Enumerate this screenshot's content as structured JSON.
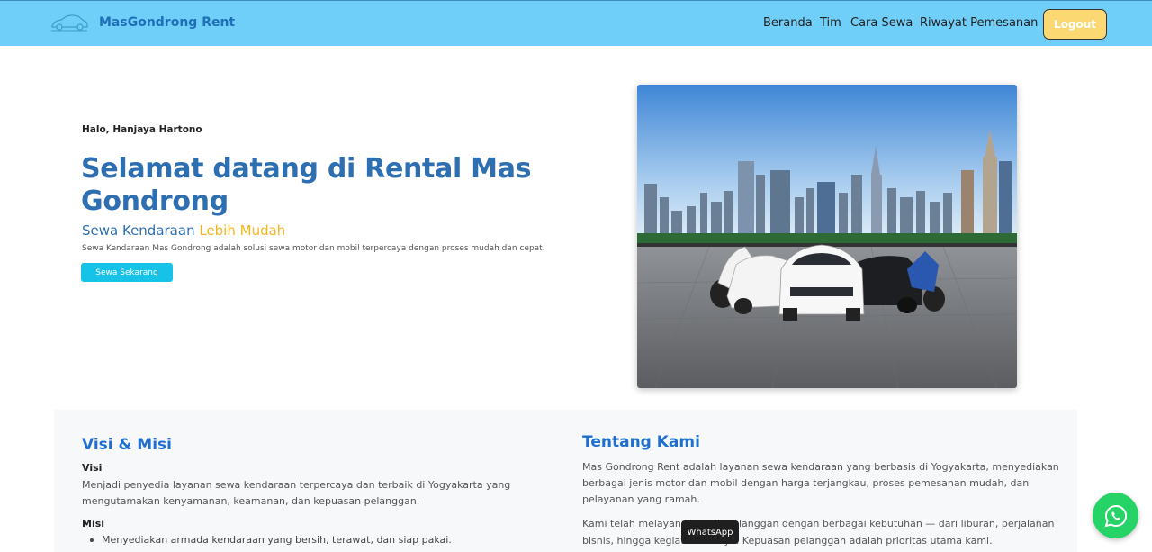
{
  "navbar": {
    "brand": "MasGondrong Rent",
    "links": [
      "Beranda",
      "Tim",
      "Cara Sewa",
      "Riwayat Pemesanan"
    ],
    "logout": "Logout"
  },
  "hero": {
    "greeting": "Halo, Hanjaya Hartono",
    "title": "Selamat datang di Rental Mas Gondrong",
    "tagline_main": "Sewa Kendaraan ",
    "tagline_accent": "Lebih Mudah",
    "description": "Sewa Kendaraan Mas Gondrong adalah solusi sewa motor dan mobil terpercaya dengan proses mudah dan cepat.",
    "cta": "Sewa Sekarang"
  },
  "visi_misi": {
    "title": "Visi & Misi",
    "visi_label": "Visi",
    "visi_text": "Menjadi penyedia layanan sewa kendaraan terpercaya dan terbaik di Yogyakarta yang mengutamakan kenyamanan, keamanan, dan kepuasan pelanggan.",
    "misi_label": "Misi",
    "misi_items": [
      "Menyediakan armada kendaraan yang bersih, terawat, dan siap pakai."
    ]
  },
  "tentang": {
    "title": "Tentang Kami",
    "para1": "Mas Gondrong Rent adalah layanan sewa kendaraan yang berbasis di Yogyakarta, menyediakan berbagai jenis motor dan mobil dengan harga terjangkau, proses pemesanan mudah, dan pelayanan yang ramah.",
    "para2_line1": "Kami telah melayani banyak pelanggan dengan berbagai kebutuhan — dari liburan, perjalanan",
    "para2_line2": "bisnis, hingga kegiatan lainnya. Kepuasan pelanggan adalah prioritas utama kami."
  },
  "whatsapp": {
    "tooltip": "WhatsApp"
  },
  "colors": {
    "navbar": "#6fcff8",
    "primary": "#2d6fb0",
    "accent": "#f5b51e",
    "cta": "#16c2e8",
    "whatsapp": "#25d366"
  }
}
